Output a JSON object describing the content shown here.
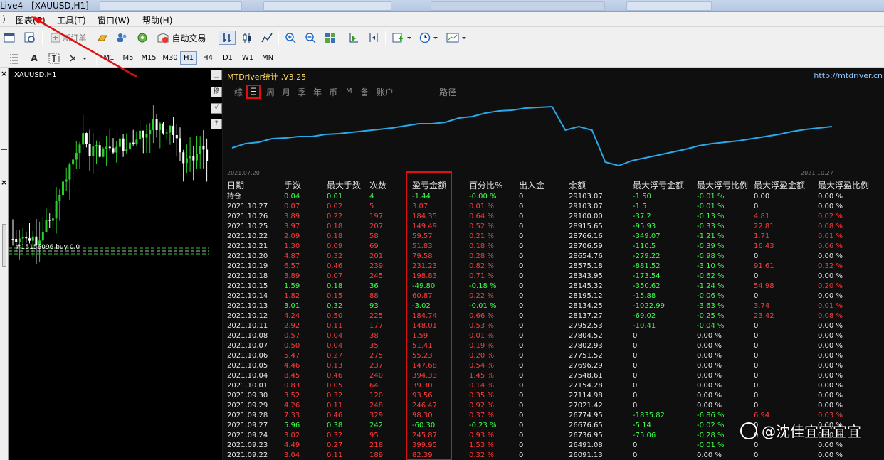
{
  "window": {
    "title": "Live4 - [XAUUSD,H1]"
  },
  "menu": {
    "items": [
      "图表(C)",
      "工具(T)",
      "窗口(W)",
      "帮助(H)"
    ]
  },
  "toolbar": {
    "new_order": "新订单",
    "auto_trade": "自动交易",
    "timeframes": [
      "M1",
      "M5",
      "M15",
      "M30",
      "H1",
      "H4",
      "D1",
      "W1",
      "MN"
    ],
    "active_timeframe": "H1"
  },
  "chart": {
    "symbol": "XAUUSD,H1",
    "overlay_text": "#15156096 buy 0.0",
    "colors": {
      "bull": "#2bd12b",
      "bear": "#ffffff",
      "background": "#000000"
    }
  },
  "stats": {
    "title": "MTDriver统计 ,V3.25",
    "url": "http://mtdriver.cn",
    "tabs": [
      "综",
      "日",
      "周",
      "月",
      "季",
      "年",
      "币",
      "M",
      "备",
      "账户",
      "路径"
    ],
    "active_tab": "日",
    "equity_curve": {
      "start_label": "2021.07.20",
      "end_label": "2021.10.27",
      "points": [
        0.3,
        0.36,
        0.38,
        0.43,
        0.44,
        0.46,
        0.46,
        0.49,
        0.5,
        0.52,
        0.54,
        0.56,
        0.58,
        0.61,
        0.64,
        0.64,
        0.66,
        0.72,
        0.74,
        0.79,
        0.82,
        0.83,
        0.86,
        0.87,
        0.88,
        0.55,
        0.6,
        0.55,
        0.1,
        0.05,
        0.12,
        0.16,
        0.2,
        0.24,
        0.28,
        0.33,
        0.36,
        0.38,
        0.4,
        0.43,
        0.46,
        0.49,
        0.53,
        0.56,
        0.58,
        0.6
      ]
    },
    "columns": [
      "日期",
      "手数",
      "最大手数",
      "次数",
      "盈亏金额",
      "百分比%",
      "出入金",
      "余额",
      "最大浮亏金额",
      "最大浮亏比例",
      "最大浮盈金额",
      "最大浮盈比例"
    ],
    "rows": [
      [
        "持仓",
        "0.04",
        "0.01",
        "4",
        "-1.44",
        "-0.00 %",
        "0",
        "29103.07",
        "-1.50",
        "-0.01 %",
        "0.00",
        "0.00 %"
      ],
      [
        "2021.10.27",
        "0.07",
        "0.02",
        "5",
        "3.07",
        "0.01 %",
        "0",
        "29103.07",
        "-1.5",
        "-0.01 %",
        "0",
        "0.00 %"
      ],
      [
        "2021.10.26",
        "3.89",
        "0.22",
        "197",
        "184.35",
        "0.64 %",
        "0",
        "29100.00",
        "-37.2",
        "-0.13 %",
        "4.81",
        "0.02 %"
      ],
      [
        "2021.10.25",
        "3.97",
        "0.18",
        "207",
        "149.49",
        "0.52 %",
        "0",
        "28915.65",
        "-95.93",
        "-0.33 %",
        "22.81",
        "0.08 %"
      ],
      [
        "2021.10.22",
        "2.09",
        "0.18",
        "58",
        "59.57",
        "0.21 %",
        "0",
        "28766.16",
        "-349.07",
        "-1.21 %",
        "1.71",
        "0.01 %"
      ],
      [
        "2021.10.21",
        "1.30",
        "0.09",
        "69",
        "51.83",
        "0.18 %",
        "0",
        "28706.59",
        "-110.5",
        "-0.39 %",
        "16.43",
        "0.06 %"
      ],
      [
        "2021.10.20",
        "4.87",
        "0.32",
        "201",
        "79.58",
        "0.28 %",
        "0",
        "28654.76",
        "-279.22",
        "-0.98 %",
        "0",
        "0.00 %"
      ],
      [
        "2021.10.19",
        "6.57",
        "0.46",
        "239",
        "231.23",
        "0.82 %",
        "0",
        "28575.18",
        "-881.52",
        "-3.10 %",
        "91.61",
        "0.32 %"
      ],
      [
        "2021.10.18",
        "3.89",
        "0.07",
        "245",
        "198.83",
        "0.71 %",
        "0",
        "28343.95",
        "-173.54",
        "-0.62 %",
        "0",
        "0.00 %"
      ],
      [
        "2021.10.15",
        "1.59",
        "0.18",
        "36",
        "-49.80",
        "-0.18 %",
        "0",
        "28145.32",
        "-350.62",
        "-1.24 %",
        "54.98",
        "0.20 %"
      ],
      [
        "2021.10.14",
        "1.82",
        "0.15",
        "88",
        "60.87",
        "0.22 %",
        "0",
        "28195.12",
        "-15.88",
        "-0.06 %",
        "0",
        "0.00 %"
      ],
      [
        "2021.10.13",
        "3.01",
        "0.32",
        "93",
        "-3.02",
        "-0.01 %",
        "0",
        "28134.25",
        "-1022.99",
        "-3.63 %",
        "3.74",
        "0.01 %"
      ],
      [
        "2021.10.12",
        "4.24",
        "0.50",
        "225",
        "184.74",
        "0.66 %",
        "0",
        "28137.27",
        "-69.02",
        "-0.25 %",
        "23.42",
        "0.08 %"
      ],
      [
        "2021.10.11",
        "2.92",
        "0.11",
        "177",
        "148.01",
        "0.53 %",
        "0",
        "27952.53",
        "-10.41",
        "-0.04 %",
        "0",
        "0.00 %"
      ],
      [
        "2021.10.08",
        "0.57",
        "0.04",
        "38",
        "1.59",
        "0.01 %",
        "0",
        "27804.52",
        "0",
        "0.00 %",
        "0",
        "0.00 %"
      ],
      [
        "2021.10.07",
        "0.50",
        "0.04",
        "35",
        "51.41",
        "0.19 %",
        "0",
        "27802.93",
        "0",
        "0.00 %",
        "0",
        "0.00 %"
      ],
      [
        "2021.10.06",
        "5.47",
        "0.27",
        "275",
        "55.23",
        "0.20 %",
        "0",
        "27751.52",
        "0",
        "0.00 %",
        "0",
        "0.00 %"
      ],
      [
        "2021.10.05",
        "4.46",
        "0.13",
        "237",
        "147.68",
        "0.54 %",
        "0",
        "27696.29",
        "0",
        "0.00 %",
        "0",
        "0.00 %"
      ],
      [
        "2021.10.04",
        "8.45",
        "0.46",
        "240",
        "394.33",
        "1.45 %",
        "0",
        "27548.61",
        "0",
        "0.00 %",
        "0",
        "0.00 %"
      ],
      [
        "2021.10.01",
        "0.83",
        "0.05",
        "64",
        "39.30",
        "0.14 %",
        "0",
        "27154.28",
        "0",
        "0.00 %",
        "0",
        "0.00 %"
      ],
      [
        "2021.09.30",
        "3.52",
        "0.32",
        "120",
        "93.56",
        "0.35 %",
        "0",
        "27114.98",
        "0",
        "0.00 %",
        "0",
        "0.00 %"
      ],
      [
        "2021.09.29",
        "4.26",
        "0.11",
        "248",
        "246.47",
        "0.92 %",
        "0",
        "27021.42",
        "0",
        "0.00 %",
        "0",
        "0.00 %"
      ],
      [
        "2021.09.28",
        "7.33",
        "0.46",
        "329",
        "98.30",
        "0.37 %",
        "0",
        "26774.95",
        "-1835.82",
        "-6.86 %",
        "6.94",
        "0.03 %"
      ],
      [
        "2021.09.27",
        "5.96",
        "0.38",
        "242",
        "-60.30",
        "-0.23 %",
        "0",
        "26676.65",
        "-5.14",
        "-0.02 %",
        "0",
        "0.00 %"
      ],
      [
        "2021.09.24",
        "3.02",
        "0.32",
        "95",
        "245.87",
        "0.93 %",
        "0",
        "26736.95",
        "-75.06",
        "-0.28 %",
        "0",
        "0.00 %"
      ],
      [
        "2021.09.23",
        "4.49",
        "0.27",
        "218",
        "399.95",
        "1.53 %",
        "0",
        "26491.08",
        "0",
        "-0.01 %",
        "0",
        "0.00 %"
      ],
      [
        "2021.09.22",
        "3.04",
        "0.11",
        "189",
        "82.39",
        "0.32 %",
        "0",
        "26091.13",
        "0",
        "0.00 %",
        "0",
        "0.00 %"
      ]
    ],
    "colors": {
      "profit": "#ff3a3a",
      "loss": "#3cff4a",
      "neutral": "#e8e8e8",
      "curve": "#29a8ea",
      "highlight_box": "#e01010"
    }
  },
  "watermark": {
    "text": "@沈佳宜宜宜宜"
  }
}
